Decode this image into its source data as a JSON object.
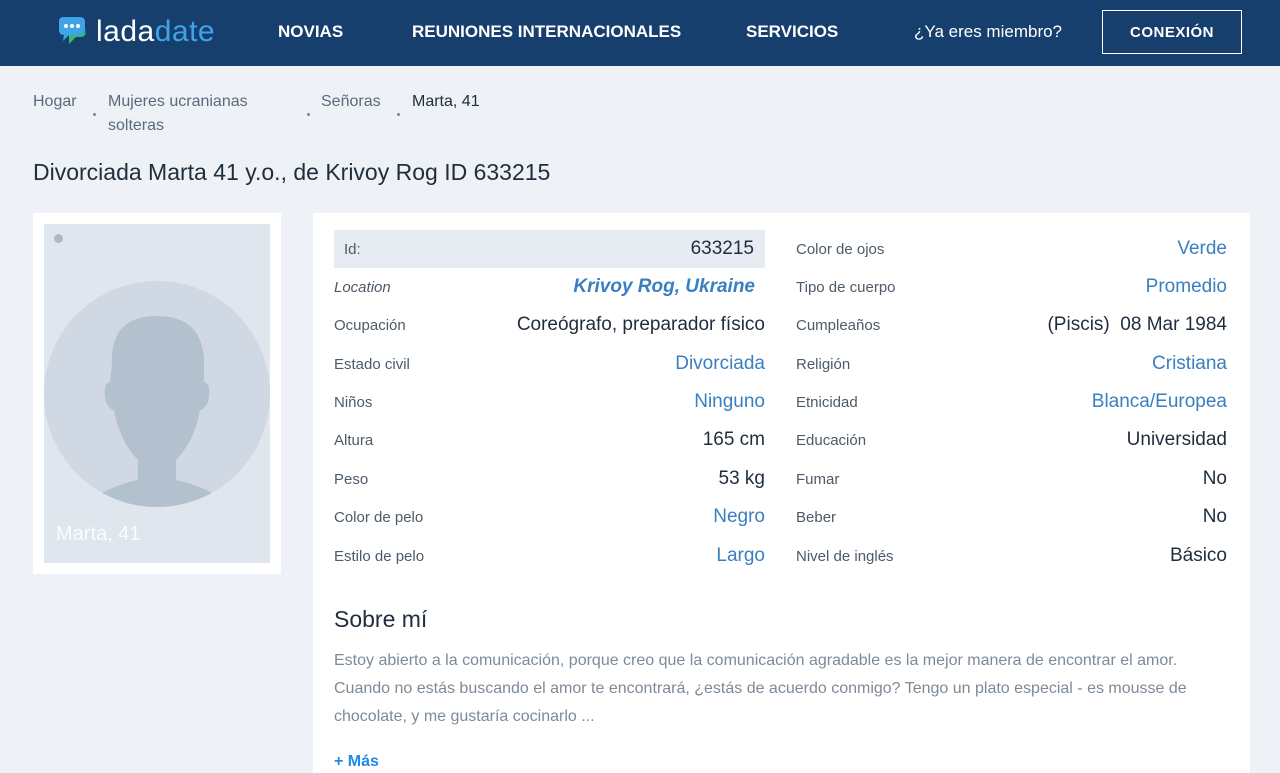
{
  "header": {
    "logo_part1": "lada",
    "logo_part2": "date",
    "nav": [
      "NOVIAS",
      "REUNIONES INTERNACIONALES",
      "SERVICIOS"
    ],
    "member_question": "¿Ya eres miembro?",
    "login_label": "CONEXIÓN"
  },
  "breadcrumb": {
    "home": "Hogar",
    "cat1_line1": "Mujeres ucranianas",
    "cat1_line2": "solteras",
    "cat2": "Señoras",
    "current": "Marta, 41"
  },
  "page_title": "Divorciada Marta 41 y.o., de Krivoy Rog ID 633215",
  "photo": {
    "caption": "Marta, 41",
    "avatar_icon": "user-silhouette-icon",
    "status_icon": "offline-dot-icon"
  },
  "profile_left": [
    {
      "label": "Id:",
      "value": "633215"
    },
    {
      "label": "Location",
      "value": "Krivoy Rog, Ukraine"
    },
    {
      "label": "Ocupación",
      "value": "Coreógrafo, preparador físico"
    },
    {
      "label": "Estado civil",
      "value": "Divorciada"
    },
    {
      "label": "Niños",
      "value": "Ninguno"
    },
    {
      "label": "Altura",
      "value": "165 cm"
    },
    {
      "label": "Peso",
      "value": "53 kg"
    },
    {
      "label": "Color de pelo",
      "value": "Negro"
    },
    {
      "label": "Estilo de pelo",
      "value": "Largo"
    }
  ],
  "profile_right": [
    {
      "label": "Color de ojos",
      "value": "Verde"
    },
    {
      "label": "Tipo de cuerpo",
      "value": "Promedio"
    },
    {
      "label": "Cumpleaños",
      "value": "(Piscis)  08 Mar 1984"
    },
    {
      "label": "Religión",
      "value": "Cristiana"
    },
    {
      "label": "Etnicidad",
      "value": "Blanca/Europea"
    },
    {
      "label": "Educación",
      "value": "Universidad"
    },
    {
      "label": "Fumar",
      "value": "No"
    },
    {
      "label": "Beber",
      "value": "No"
    },
    {
      "label": "Nivel de inglés",
      "value": "Básico"
    }
  ],
  "about": {
    "title": "Sobre mí",
    "text": "Estoy abierto a la comunicación, porque creo que la comunicación agradable es la mejor manera de encontrar el amor. Cuando no estás buscando el amor te encontrará, ¿estás de acuerdo conmigo? Tengo un plato especial - es mousse de chocolate, y me gustaría cocinarlo ...",
    "more_label": "+ Más"
  },
  "colors": {
    "header_bg": "#163f6e",
    "accent": "#3a7fbf",
    "page_bg": "#eef2f7",
    "link_bright": "#1d8be8"
  }
}
